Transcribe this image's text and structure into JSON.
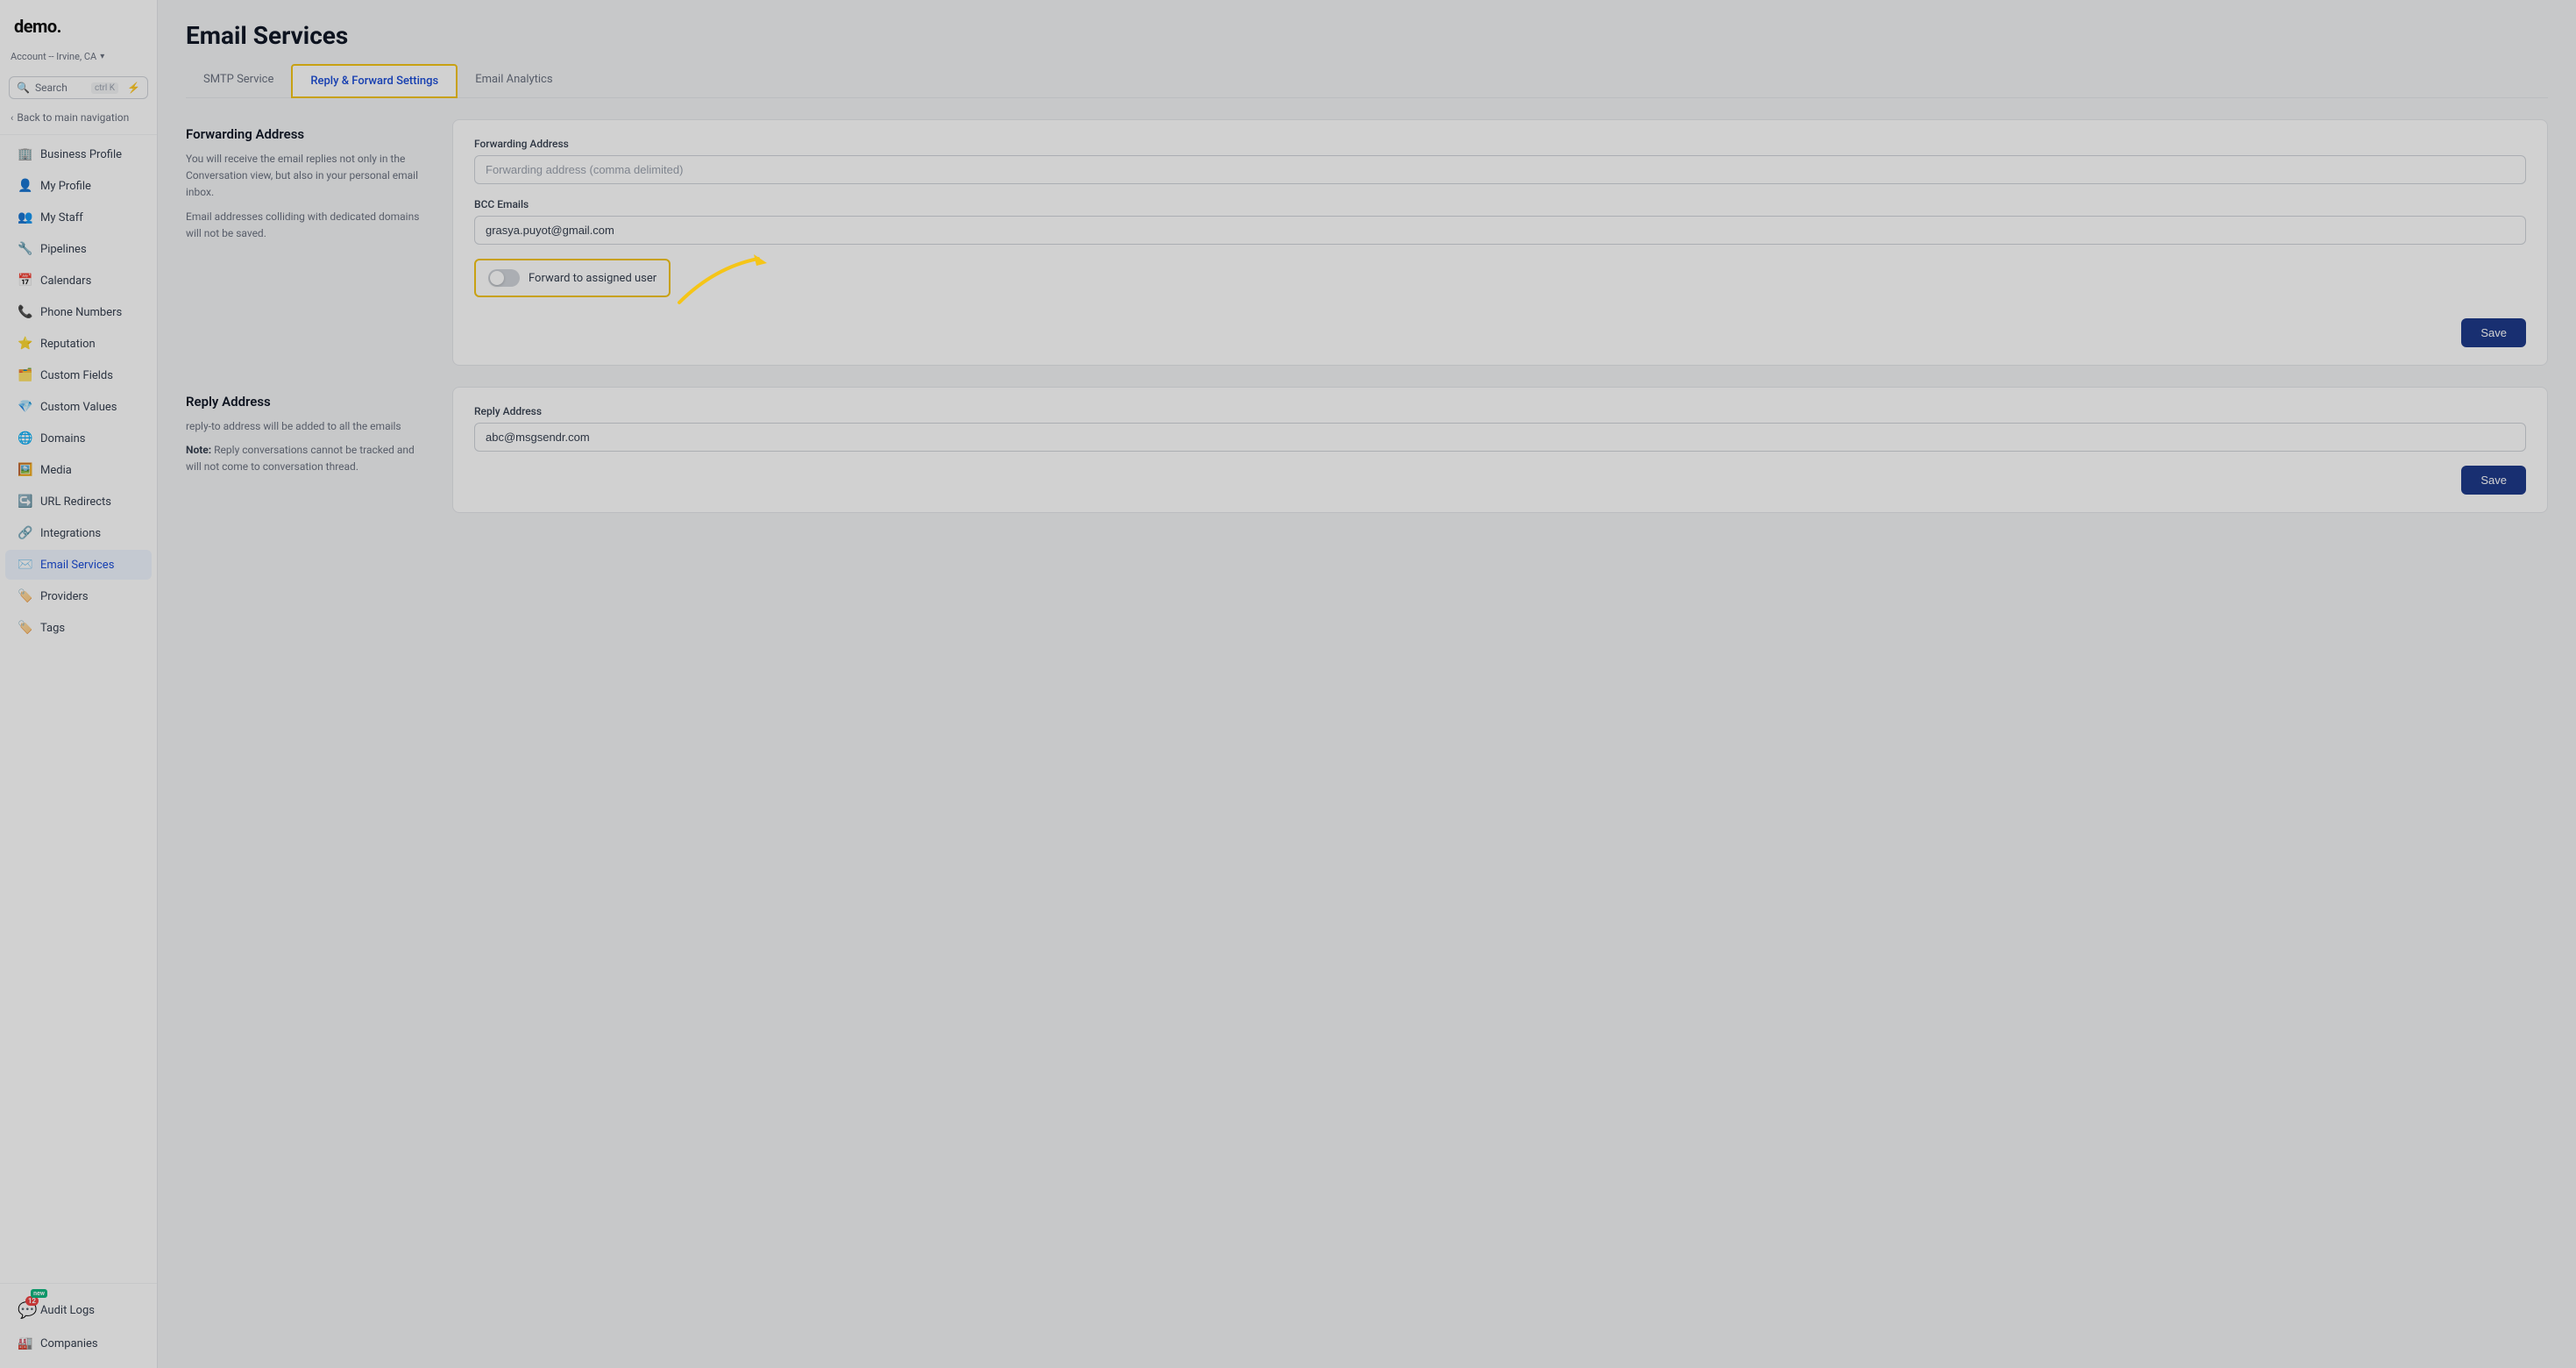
{
  "app": {
    "logo": "demo.",
    "account": "Account -- Irvine, CA"
  },
  "sidebar": {
    "search_label": "Search",
    "search_shortcut": "ctrl K",
    "back_nav": "Back to main navigation",
    "items": [
      {
        "id": "business-profile",
        "label": "Business Profile",
        "icon": "🏢"
      },
      {
        "id": "my-profile",
        "label": "My Profile",
        "icon": "👤"
      },
      {
        "id": "my-staff",
        "label": "My Staff",
        "icon": "👥"
      },
      {
        "id": "pipelines",
        "label": "Pipelines",
        "icon": "🔧"
      },
      {
        "id": "calendars",
        "label": "Calendars",
        "icon": "📅"
      },
      {
        "id": "phone-numbers",
        "label": "Phone Numbers",
        "icon": "📞"
      },
      {
        "id": "reputation",
        "label": "Reputation",
        "icon": "⭐"
      },
      {
        "id": "custom-fields",
        "label": "Custom Fields",
        "icon": "🗂️"
      },
      {
        "id": "custom-values",
        "label": "Custom Values",
        "icon": "💎"
      },
      {
        "id": "domains",
        "label": "Domains",
        "icon": "🌐"
      },
      {
        "id": "media",
        "label": "Media",
        "icon": "🖼️"
      },
      {
        "id": "url-redirects",
        "label": "URL Redirects",
        "icon": "↪️"
      },
      {
        "id": "integrations",
        "label": "Integrations",
        "icon": "🔗"
      },
      {
        "id": "email-services",
        "label": "Email Services",
        "icon": "✉️"
      },
      {
        "id": "providers",
        "label": "Providers",
        "icon": "🏷️"
      },
      {
        "id": "tags",
        "label": "Tags",
        "icon": "🏷️"
      }
    ],
    "bottom_items": [
      {
        "id": "audit-logs",
        "label": "Audit Logs",
        "icon": "📋",
        "badge": "12",
        "badge_new": "new"
      },
      {
        "id": "companies",
        "label": "Companies",
        "icon": "🏭"
      }
    ]
  },
  "page": {
    "title": "Email Services"
  },
  "tabs": [
    {
      "id": "smtp-service",
      "label": "SMTP Service",
      "active": false
    },
    {
      "id": "reply-forward-settings",
      "label": "Reply & Forward Settings",
      "active": true
    },
    {
      "id": "email-analytics",
      "label": "Email Analytics",
      "active": false
    }
  ],
  "forwarding_section": {
    "heading": "Forwarding Address",
    "description1": "You will receive the email replies not only in the Conversation view, but also in your personal email inbox.",
    "description2": "Email addresses colliding with dedicated domains will not be saved.",
    "form": {
      "forwarding_label": "Forwarding Address",
      "forwarding_placeholder": "Forwarding address (comma delimited)",
      "forwarding_value": "",
      "bcc_label": "BCC Emails",
      "bcc_value": "grasya.puyot@gmail.com"
    },
    "toggle": {
      "label": "Forward to assigned user",
      "checked": false
    },
    "save_button": "Save"
  },
  "reply_section": {
    "heading": "Reply Address",
    "description1": "reply-to address will be added to all the emails",
    "note": "Note:",
    "note_text": "Reply conversations cannot be tracked and will not come to conversation thread.",
    "form": {
      "reply_label": "Reply Address",
      "reply_value": "abc@msgsendr.com"
    },
    "save_button": "Save"
  }
}
